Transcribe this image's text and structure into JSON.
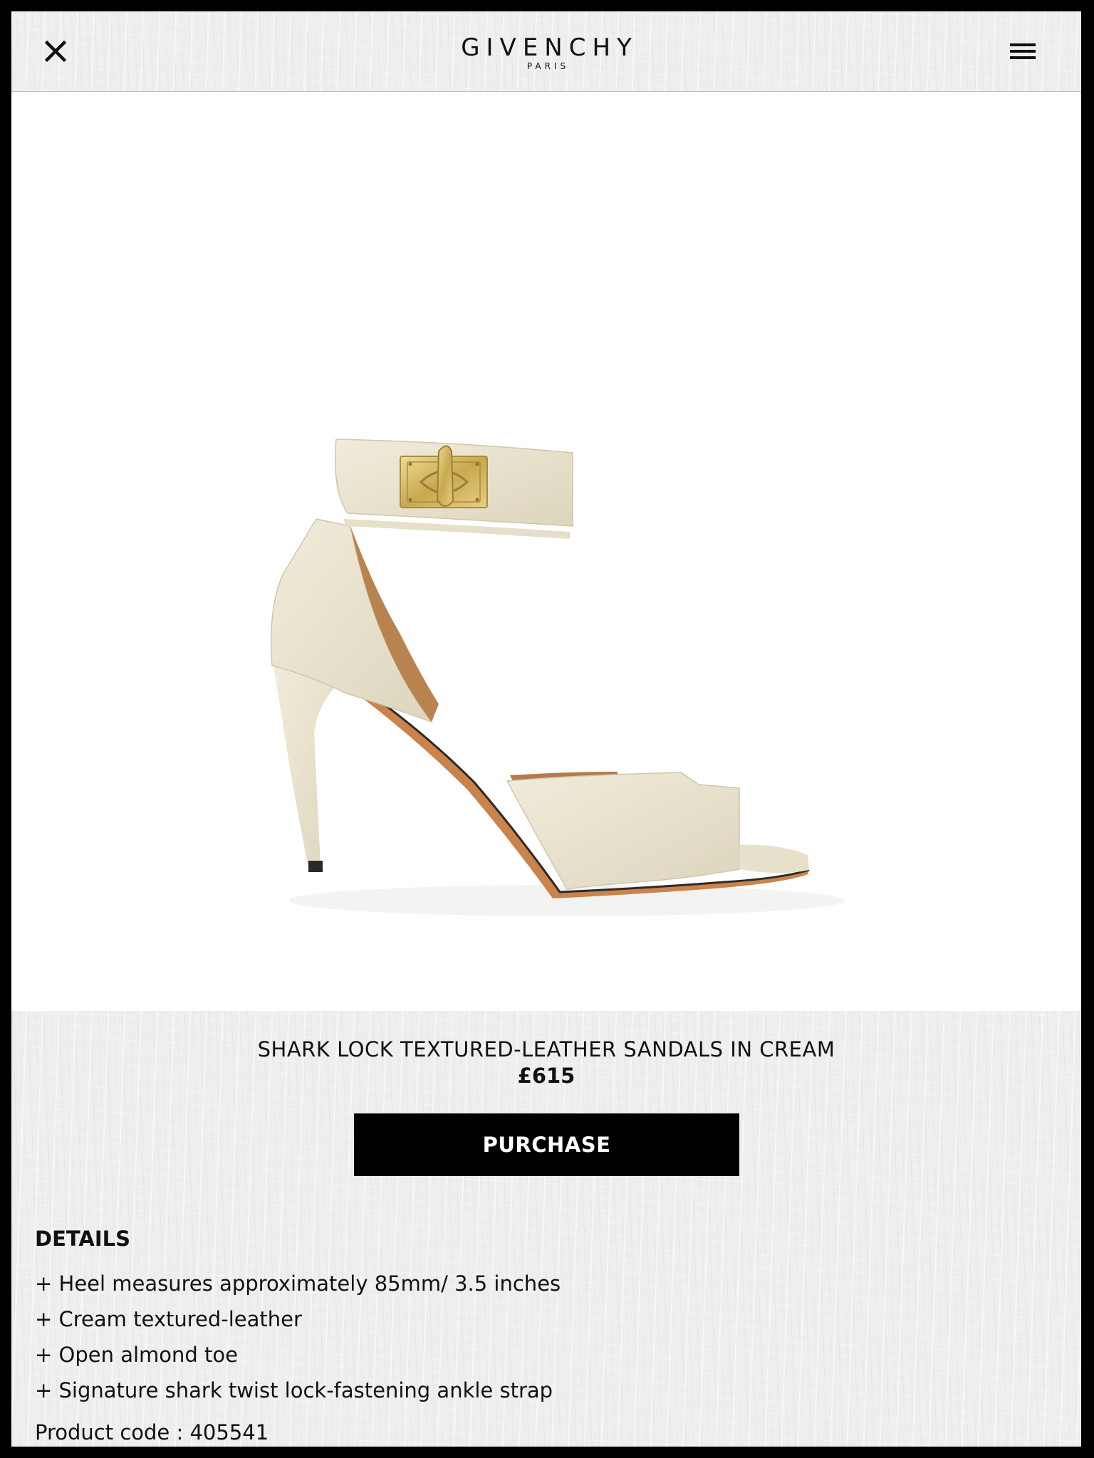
{
  "header": {
    "logo_main": "GIVENCHY",
    "logo_sub": "PARIS",
    "close_icon": "close-icon",
    "menu_icon": "hamburger-menu-icon"
  },
  "product": {
    "image": "cream-sandal-product-photo",
    "title": "SHARK LOCK TEXTURED-LEATHER SANDALS IN CREAM",
    "price": "£615",
    "purchase_label": "PURCHASE"
  },
  "details": {
    "heading": "DETAILS",
    "items": [
      "+ Heel measures approximately 85mm/ 3.5 inches",
      "+ Cream textured-leather",
      "+ Open almond toe",
      "+ Signature shark twist lock-fastening ankle strap"
    ],
    "product_code": "Product code : 405541"
  },
  "colors": {
    "purchase_bg": "#000000",
    "purchase_text": "#ffffff",
    "leather": "#ece6d2",
    "hardware": "#d2b868"
  }
}
